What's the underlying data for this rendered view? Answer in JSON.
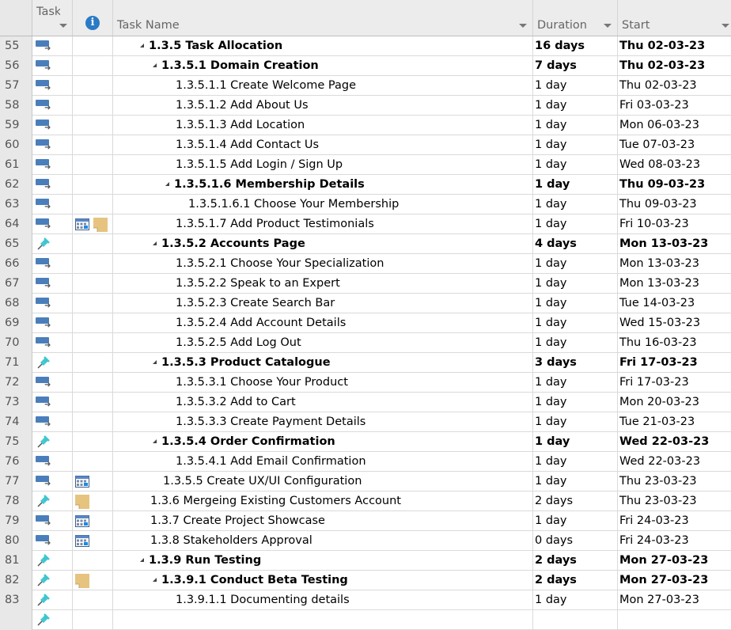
{
  "header": {
    "task_mode_label": "Task Mode",
    "info_symbol": "i",
    "task_name_label": "Task Name",
    "duration_label": "Duration",
    "start_label": "Start"
  },
  "colors": {
    "auto_scheduled": "#4a7ebb",
    "manual_pin": "#3fc6cf",
    "note": "#e6c47f",
    "info": "#2a7ac6"
  },
  "rows": [
    {
      "id": "55",
      "mode": "auto",
      "indicators": [],
      "level": 0,
      "summary": true,
      "name": "1.3.5 Task Allocation",
      "duration": "16 days",
      "start": "Thu 02-03-23"
    },
    {
      "id": "56",
      "mode": "auto",
      "indicators": [],
      "level": 1,
      "summary": true,
      "name": "1.3.5.1 Domain Creation",
      "duration": "7 days",
      "start": "Thu 02-03-23"
    },
    {
      "id": "57",
      "mode": "auto",
      "indicators": [],
      "level": 2,
      "summary": false,
      "name": "1.3.5.1.1 Create Welcome Page",
      "duration": "1 day",
      "start": "Thu 02-03-23"
    },
    {
      "id": "58",
      "mode": "auto",
      "indicators": [],
      "level": 2,
      "summary": false,
      "name": "1.3.5.1.2 Add About Us",
      "duration": "1 day",
      "start": "Fri 03-03-23"
    },
    {
      "id": "59",
      "mode": "auto",
      "indicators": [],
      "level": 2,
      "summary": false,
      "name": "1.3.5.1.3 Add Location",
      "duration": "1 day",
      "start": "Mon 06-03-23"
    },
    {
      "id": "60",
      "mode": "auto",
      "indicators": [],
      "level": 2,
      "summary": false,
      "name": "1.3.5.1.4 Add Contact Us",
      "duration": "1 day",
      "start": "Tue 07-03-23"
    },
    {
      "id": "61",
      "mode": "auto",
      "indicators": [],
      "level": 2,
      "summary": false,
      "name": "1.3.5.1.5 Add Login / Sign Up",
      "duration": "1 day",
      "start": "Wed 08-03-23"
    },
    {
      "id": "62",
      "mode": "auto",
      "indicators": [],
      "level": 2,
      "summary": true,
      "name": "1.3.5.1.6 Membership Details",
      "duration": "1 day",
      "start": "Thu 09-03-23"
    },
    {
      "id": "63",
      "mode": "auto",
      "indicators": [],
      "level": 3,
      "summary": false,
      "name": "1.3.5.1.6.1 Choose Your Membership",
      "duration": "1 day",
      "start": "Thu 09-03-23"
    },
    {
      "id": "64",
      "mode": "auto",
      "indicators": [
        "calendar",
        "note"
      ],
      "level": 2,
      "summary": false,
      "name": "1.3.5.1.7 Add Product Testimonials",
      "duration": "1 day",
      "start": "Fri 10-03-23"
    },
    {
      "id": "65",
      "mode": "manual",
      "indicators": [],
      "level": 1,
      "summary": true,
      "name": "1.3.5.2 Accounts Page",
      "duration": "4 days",
      "start": "Mon 13-03-23"
    },
    {
      "id": "66",
      "mode": "auto",
      "indicators": [],
      "level": 2,
      "summary": false,
      "name": "1.3.5.2.1 Choose Your Specialization",
      "duration": "1 day",
      "start": "Mon 13-03-23"
    },
    {
      "id": "67",
      "mode": "auto",
      "indicators": [],
      "level": 2,
      "summary": false,
      "name": "1.3.5.2.2 Speak to an Expert",
      "duration": "1 day",
      "start": "Mon 13-03-23"
    },
    {
      "id": "68",
      "mode": "auto",
      "indicators": [],
      "level": 2,
      "summary": false,
      "name": "1.3.5.2.3 Create Search Bar",
      "duration": "1 day",
      "start": "Tue 14-03-23"
    },
    {
      "id": "69",
      "mode": "auto",
      "indicators": [],
      "level": 2,
      "summary": false,
      "name": "1.3.5.2.4 Add Account Details",
      "duration": "1 day",
      "start": "Wed 15-03-23"
    },
    {
      "id": "70",
      "mode": "auto",
      "indicators": [],
      "level": 2,
      "summary": false,
      "name": "1.3.5.2.5 Add Log Out",
      "duration": "1 day",
      "start": "Thu 16-03-23"
    },
    {
      "id": "71",
      "mode": "manual",
      "indicators": [],
      "level": 1,
      "summary": true,
      "name": "1.3.5.3 Product Catalogue",
      "duration": "3 days",
      "start": "Fri 17-03-23"
    },
    {
      "id": "72",
      "mode": "auto",
      "indicators": [],
      "level": 2,
      "summary": false,
      "name": "1.3.5.3.1 Choose Your Product",
      "duration": "1 day",
      "start": "Fri 17-03-23"
    },
    {
      "id": "73",
      "mode": "auto",
      "indicators": [],
      "level": 2,
      "summary": false,
      "name": "1.3.5.3.2 Add to Cart",
      "duration": "1 day",
      "start": "Mon 20-03-23"
    },
    {
      "id": "74",
      "mode": "auto",
      "indicators": [],
      "level": 2,
      "summary": false,
      "name": "1.3.5.3.3 Create Payment Details",
      "duration": "1 day",
      "start": "Tue 21-03-23"
    },
    {
      "id": "75",
      "mode": "manual",
      "indicators": [],
      "level": 1,
      "summary": true,
      "name": "1.3.5.4 Order Confirmation",
      "duration": "1 day",
      "start": "Wed 22-03-23"
    },
    {
      "id": "76",
      "mode": "auto",
      "indicators": [],
      "level": 2,
      "summary": false,
      "name": "1.3.5.4.1 Add Email Confirmation",
      "duration": "1 day",
      "start": "Wed 22-03-23"
    },
    {
      "id": "77",
      "mode": "auto",
      "indicators": [
        "calendar"
      ],
      "level": 1,
      "summary": false,
      "name": "1.3.5.5 Create UX/UI Configuration",
      "duration": "1 day",
      "start": "Thu 23-03-23"
    },
    {
      "id": "78",
      "mode": "manual",
      "indicators": [
        "note"
      ],
      "level": 0,
      "summary": false,
      "name": "1.3.6 Mergeing Existing Customers Account",
      "duration": "2 days",
      "start": "Thu 23-03-23"
    },
    {
      "id": "79",
      "mode": "auto",
      "indicators": [
        "calendar"
      ],
      "level": 0,
      "summary": false,
      "name": "1.3.7 Create Project Showcase",
      "duration": "1 day",
      "start": "Fri 24-03-23"
    },
    {
      "id": "80",
      "mode": "auto",
      "indicators": [
        "calendar"
      ],
      "level": 0,
      "summary": false,
      "name": "1.3.8 Stakeholders Approval",
      "duration": "0 days",
      "start": "Fri 24-03-23"
    },
    {
      "id": "81",
      "mode": "manual",
      "indicators": [],
      "level": 0,
      "summary": true,
      "name": "1.3.9 Run Testing",
      "duration": "2 days",
      "start": "Mon 27-03-23"
    },
    {
      "id": "82",
      "mode": "manual",
      "indicators": [
        "note"
      ],
      "level": 1,
      "summary": true,
      "name": "1.3.9.1 Conduct Beta Testing",
      "duration": "2 days",
      "start": "Mon 27-03-23"
    },
    {
      "id": "83",
      "mode": "manual",
      "indicators": [],
      "level": 2,
      "summary": false,
      "name": "1.3.9.1.1 Documenting details",
      "duration": "1 day",
      "start": "Mon 27-03-23"
    },
    {
      "id": "",
      "mode": "manual",
      "indicators": [],
      "level": 0,
      "summary": false,
      "name": "",
      "duration": "",
      "start": ""
    }
  ]
}
